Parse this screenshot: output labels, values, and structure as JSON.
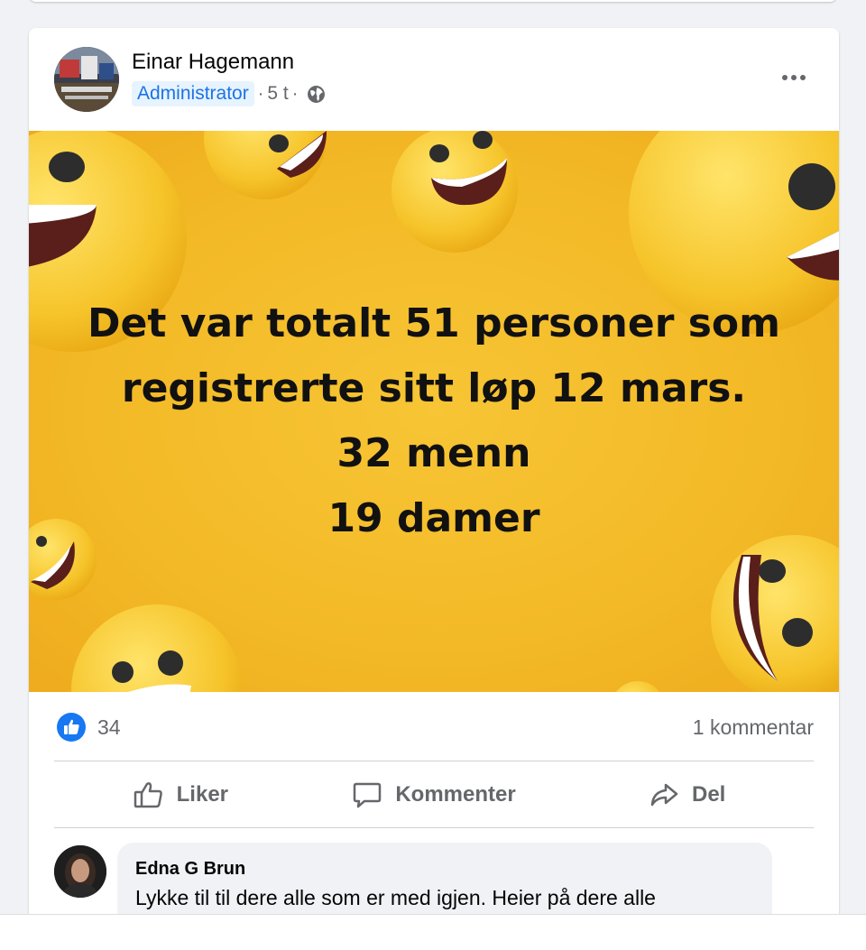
{
  "post": {
    "author": "Einar Hagemann",
    "role": "Administrator",
    "separator": "·",
    "time": "5 t",
    "more_icon": "more-horizontal-icon",
    "image_text": {
      "line1": "Det var totalt 51 personer som",
      "line2": "registrerte sitt løp 12 mars.",
      "line3": "32 menn",
      "line4": "19 damer"
    },
    "reactions": {
      "icon": "like-reaction-icon",
      "count": "34",
      "comment_count": "1 kommentar"
    },
    "actions": {
      "like": "Liker",
      "comment": "Kommenter",
      "share": "Del"
    }
  },
  "comment": {
    "author": "Edna G Brun",
    "text": "Lykke til til dere alle som er med igjen. Heier på dere alle"
  },
  "colors": {
    "accent": "#1877f2",
    "badge_bg": "#e7f3ff",
    "badge_text": "#1b74e4",
    "image_bg": "#f3b926",
    "muted_text": "#65676b"
  }
}
